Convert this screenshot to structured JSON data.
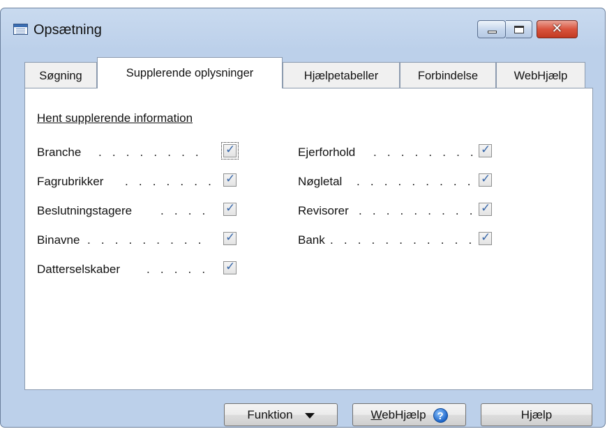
{
  "window": {
    "title": "Opsætning",
    "app_icon": "table-icon",
    "close_symbol": "✕"
  },
  "tabs": [
    {
      "label": "Søgning",
      "active": false
    },
    {
      "label": "Supplerende oplysninger",
      "active": true
    },
    {
      "label": "Hjælpetabeller",
      "active": false
    },
    {
      "label": "Forbindelse",
      "active": false
    },
    {
      "label": "WebHjælp",
      "active": false
    }
  ],
  "panel": {
    "section_label": "Hent supplerende information",
    "left_options": [
      {
        "label": "Branche",
        "dots": ". . . . . . . .",
        "checked": true
      },
      {
        "label": "Fagrubrikker",
        "dots": ". . . . . . .",
        "checked": true
      },
      {
        "label": "Beslutningstagere",
        "dots": ". . . .",
        "checked": true
      },
      {
        "label": "Binavne",
        "dots": ". . . . . . . . .",
        "checked": true
      },
      {
        "label": "Datterselskaber",
        "dots": ". . . . .",
        "checked": true
      }
    ],
    "right_options": [
      {
        "label": "Ejerforhold",
        "dots": ". . . . . . . .",
        "checked": true
      },
      {
        "label": "Nøgletal",
        "dots": ". . . . . . . . .",
        "checked": true
      },
      {
        "label": "Revisorer",
        "dots": ". . . . . . . . .",
        "checked": true
      },
      {
        "label": "Bank",
        "dots": ". . . . . . . . . . .",
        "checked": true
      }
    ]
  },
  "buttons": {
    "function_label": "Funktion",
    "webhelp_label_accel": "W",
    "webhelp_label_rest": "ebHjælp",
    "help_icon_glyph": "?",
    "help_label": "Hjælp"
  },
  "colors": {
    "window_frame": "#bcd0ea",
    "close_button": "#d9533d",
    "checkmark": "#3766a8"
  }
}
